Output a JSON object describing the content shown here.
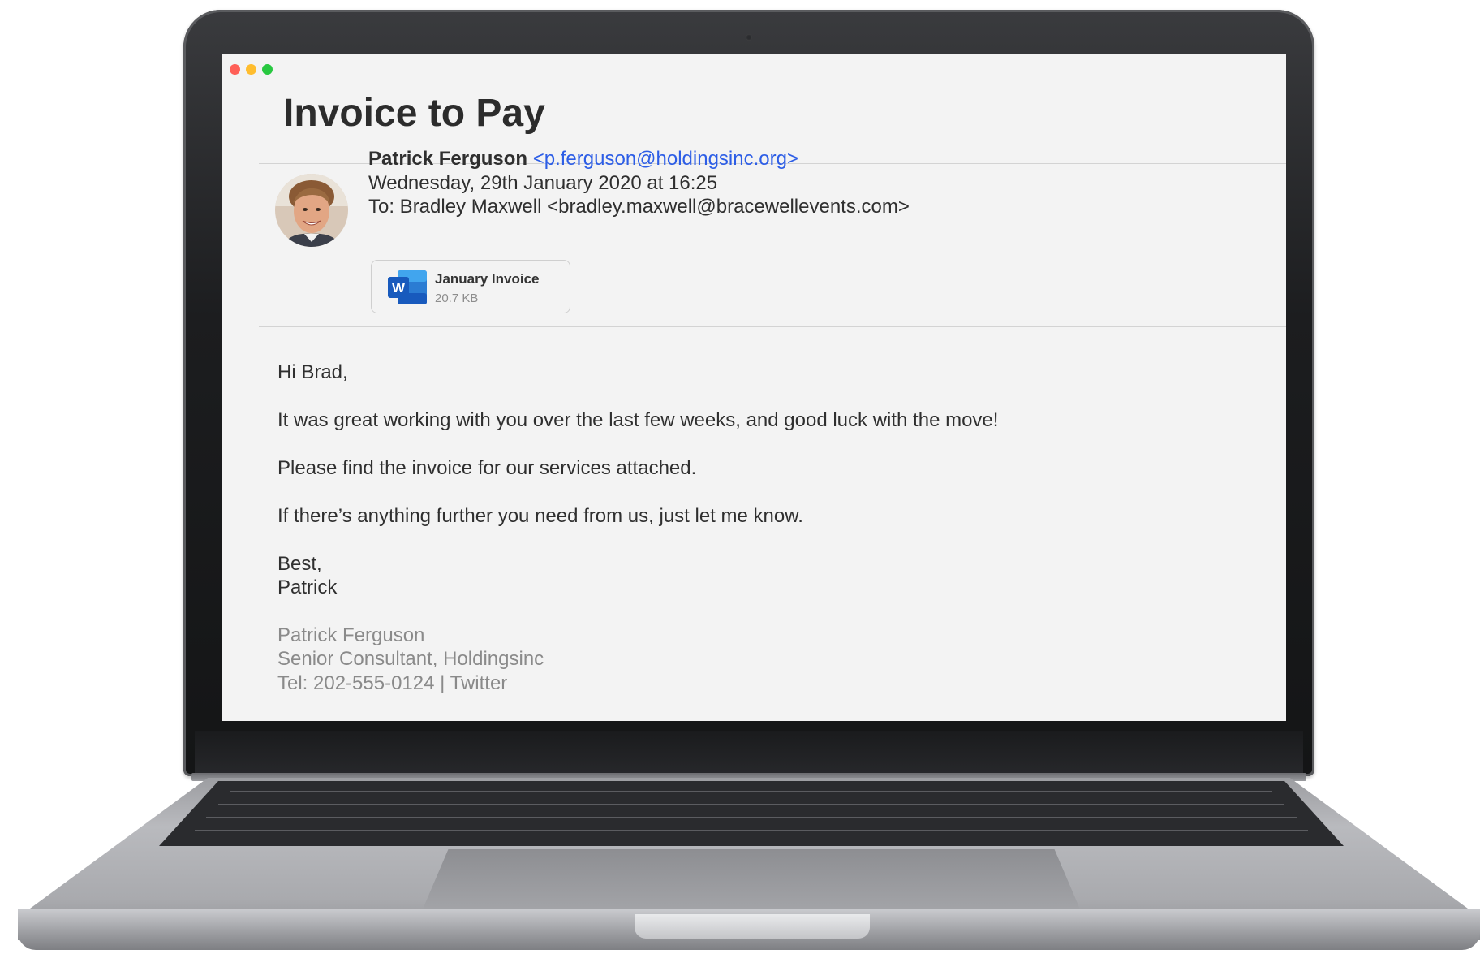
{
  "email": {
    "title": "Invoice to Pay",
    "sender_name": "Patrick Ferguson",
    "sender_email": "<p.ferguson@holdingsinc.org>",
    "date": "Wednesday, 29th January 2020 at 16:25",
    "to": "To: Bradley Maxwell <bradley.maxwell@bracewellevents.com>",
    "attachment": {
      "icon": "word-document-icon",
      "letter": "W",
      "name": "January Invoice",
      "size": "20.7 KB"
    },
    "body": {
      "greeting": "Hi Brad,",
      "paragraphs": [
        "It was great working with you over the last few weeks, and good luck with the move!",
        "Please find the invoice for our services attached.",
        "If there’s anything further you need from us, just let me know."
      ],
      "closing": "Best,",
      "sign_name": "Patrick"
    },
    "signature": {
      "name": "Patrick Ferguson",
      "role": "Senior Consultant, Holdingsinc",
      "tel": "Tel: 202-555-0124",
      "separator": " | ",
      "twitter": "Twitter"
    }
  },
  "colors": {
    "link_blue": "#2c5de6",
    "screen_bg": "#f3f3f3",
    "traffic_red": "#ff5f57",
    "traffic_yellow": "#ffbd2e",
    "traffic_green": "#28c840",
    "word_blue": "#185abd"
  }
}
